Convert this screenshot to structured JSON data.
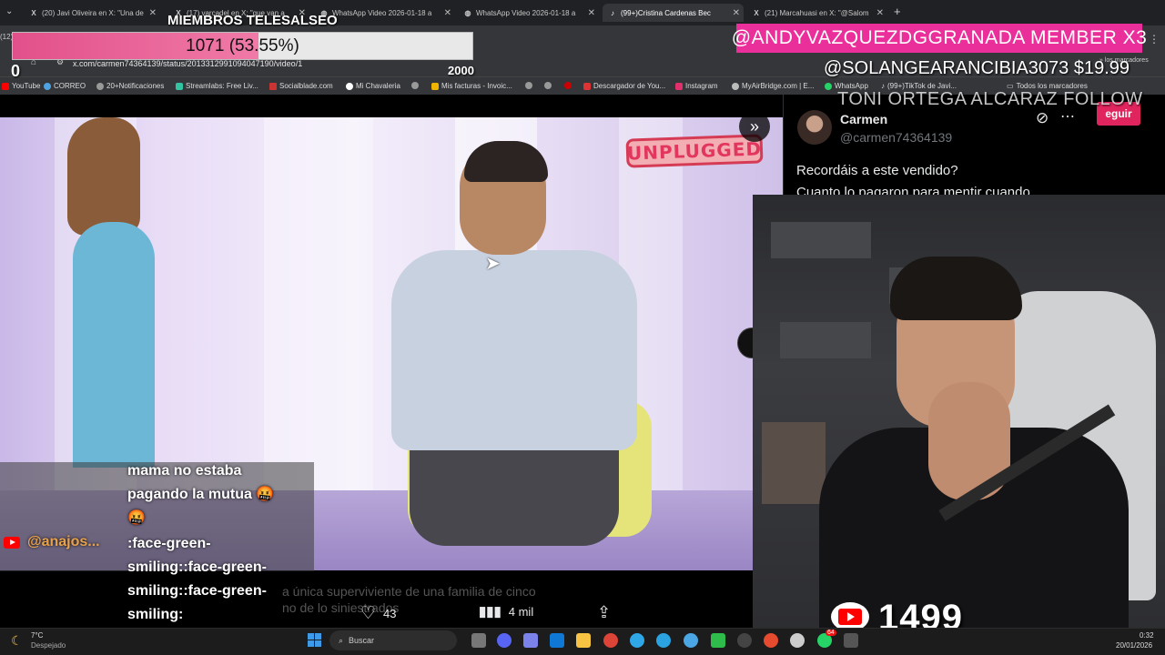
{
  "browser": {
    "tabs": [
      {
        "label": "(20) Javi Oliveira en X: \"Una de",
        "favicon": "x-logo"
      },
      {
        "label": "(17) varcadel en X: \"que van a",
        "favicon": "x-logo"
      },
      {
        "label": "WhatsApp Video 2026-01-18 a",
        "favicon": "globe"
      },
      {
        "label": "WhatsApp Video 2026-01-18 a",
        "favicon": "globe"
      },
      {
        "label": "(99+)Cristina Cardenas Bec",
        "favicon": "tiktok"
      },
      {
        "label": "(21) Marcahuasi en X: \"@Salom",
        "favicon": "x-logo"
      }
    ],
    "new_tab_label": "+",
    "url": "x.com/carmen74364139/status/2013312991094047190/video/1",
    "partial_indicator": "(12)",
    "bookmarks": [
      "YouTube",
      "CORREO",
      "20+Notificaciones",
      "Streamlabs: Free Liv...",
      "Socialblade.com",
      "Mi Chavaleria",
      "Mis facturas - Invoic...",
      "Descargador de You...",
      "Instagram",
      "MyAirBridge.com | E...",
      "WhatsApp",
      "(99+)TikTok de Javi...",
      "Todos los marcadores"
    ],
    "right_bookmark": "los marcadores"
  },
  "video": {
    "badge": "UNPLUGGED",
    "expand_icon": "double-chevron-right-icon"
  },
  "caption": {
    "line1": "a única superviviente de una familia de cinco",
    "line2": "no de lo                  siniestrados"
  },
  "metrics": {
    "likes": "43",
    "views": "4 mil"
  },
  "chat": {
    "lines": [
      "mama no estaba",
      "pagando la mutua 🤬",
      "🤬",
      ":face-green-",
      "smiling::face-green-",
      "smiling::face-green-",
      "smiling:"
    ],
    "username": "@anajos..."
  },
  "tweet": {
    "name": "Carmen",
    "handle": "@carmen74364139",
    "text1": "Recordáis a este vendido?",
    "text2": "Cuanto lo pagaron para mentir cuando",
    "follow_label": "eguir"
  },
  "overlays": {
    "goal_title": "MIEMBROS TELESALSEO",
    "goal_text": "1071 (53.55%)",
    "goal_progress": 0.5355,
    "goal_min": "0",
    "goal_max": "2000",
    "member_alert": "@ANDYVAZQUEZDGGRANADA  MEMBER X3",
    "superchat_alert": "@SOLANGEARANCIBIA3073  $19.99",
    "follow_alert": "TONI ORTEGA ALCARAZ  FOLLOW",
    "sub_count": "1499",
    "colors": {
      "member_bg": "#ea2f9b",
      "goal_fill": "#e2508a",
      "yt_red": "#ff0000"
    }
  },
  "taskbar": {
    "temp": "7°C",
    "weather": "Despejado",
    "search": "Buscar",
    "time": "0:32",
    "date": "20/01/2026",
    "badge": "64"
  }
}
